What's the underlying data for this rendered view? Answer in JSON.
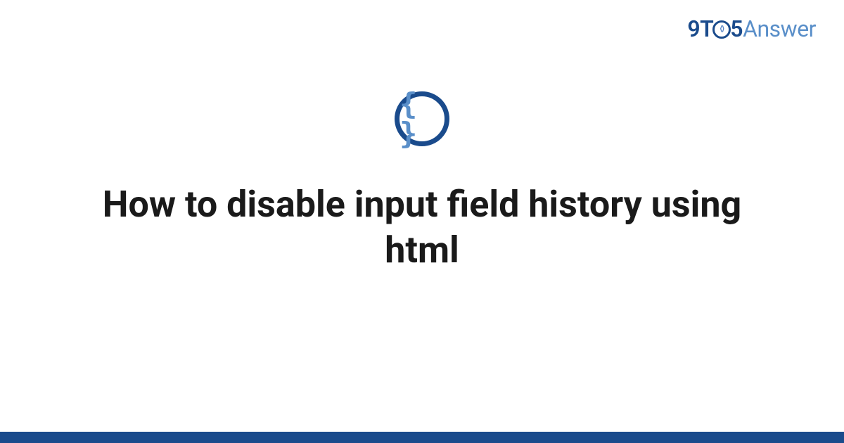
{
  "logo": {
    "part1": "9T",
    "part2": "5",
    "part3": "Answer"
  },
  "icon": {
    "braces": "{ }"
  },
  "title": "How to disable input field history using html",
  "colors": {
    "brand_dark": "#1a4b8c",
    "brand_light": "#5a8fc9",
    "text": "#1a1a1a"
  }
}
